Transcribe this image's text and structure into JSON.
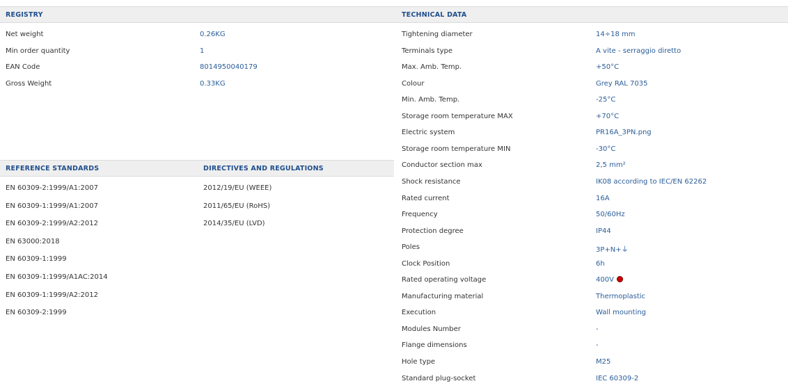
{
  "registry": {
    "header": "REGISTRY",
    "rows": [
      {
        "label": "Net weight",
        "value": "0.26KG"
      },
      {
        "label": "Min order quantity",
        "value": "1"
      },
      {
        "label": "EAN Code",
        "value": "8014950040179"
      },
      {
        "label": "Gross Weight",
        "value": "0.33KG"
      }
    ]
  },
  "technical": {
    "header": "TECHNICAL DATA",
    "rows": [
      {
        "label": "Tightening diameter",
        "value": "14÷18 mm"
      },
      {
        "label": "Terminals type",
        "value": "A vite - serraggio diretto"
      },
      {
        "label": "Max. Amb. Temp.",
        "value": "+50°C"
      },
      {
        "label": "Colour",
        "value": "Grey RAL 7035"
      },
      {
        "label": "Min. Amb. Temp.",
        "value": "-25°C"
      },
      {
        "label": "Storage room temperature MAX",
        "value": "+70°C"
      },
      {
        "label": "Electric system",
        "value": "PR16A_3PN.png"
      },
      {
        "label": "Storage room temperature MIN",
        "value": "-30°C"
      },
      {
        "label": "Conductor section max",
        "value": "2,5 mm²"
      },
      {
        "label": "Shock resistance",
        "value": "IK08 according to IEC/EN 62262"
      },
      {
        "label": "Rated current",
        "value": "16A"
      },
      {
        "label": "Frequency",
        "value": "50/60Hz"
      },
      {
        "label": "Protection degree",
        "value": "IP44"
      },
      {
        "label": "Poles",
        "value": "3P+N+⏚"
      },
      {
        "label": "Clock Position",
        "value": "6h"
      },
      {
        "label": "Rated operating voltage",
        "value": "400V",
        "indicator_color": "#d10000"
      },
      {
        "label": "Manufacturing material",
        "value": "Thermoplastic"
      },
      {
        "label": "Execution",
        "value": "Wall mounting"
      },
      {
        "label": "Modules Number",
        "value": "-"
      },
      {
        "label": "Flange dimensions",
        "value": "-"
      },
      {
        "label": "Hole type",
        "value": "M25"
      },
      {
        "label": "Standard plug-socket",
        "value": "IEC 60309-2"
      }
    ]
  },
  "reference_standards": {
    "header": "REFERENCE STANDARDS",
    "items": [
      "EN 60309-2:1999/A1:2007",
      "EN 60309-1:1999/A1:2007",
      "EN 60309-2:1999/A2:2012",
      "EN 63000:2018",
      "EN 60309-1:1999",
      "EN 60309-1:1999/A1AC:2014",
      "EN 60309-1:1999/A2:2012",
      "EN 60309-2:1999"
    ]
  },
  "directives": {
    "header": "DIRECTIVES AND REGULATIONS",
    "items": [
      "2012/19/EU (WEEE)",
      "2011/65/EU (RoHS)",
      "2014/35/EU (LVD)"
    ]
  },
  "colors": {
    "header_text": "#1f4e8c",
    "value_text": "#2a5d99",
    "header_bg": "#efefef"
  }
}
